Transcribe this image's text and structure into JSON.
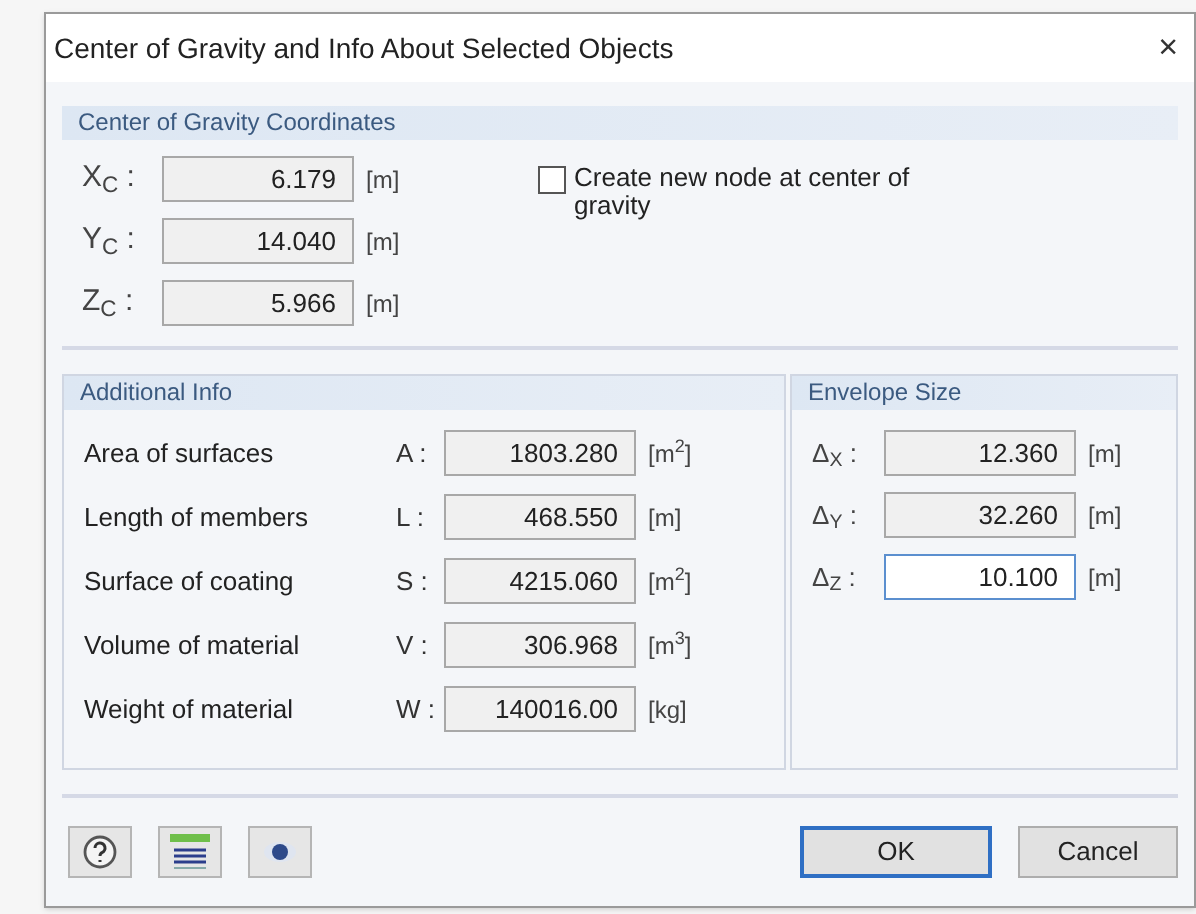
{
  "window": {
    "title": "Center of Gravity and Info About Selected Objects",
    "close": "×"
  },
  "coordinates": {
    "title": "Center of Gravity Coordinates",
    "rows": [
      {
        "label": "X$_{C}$ :",
        "value": "6.179",
        "unit": "[m]"
      },
      {
        "label": "Y$_{C}$ :",
        "value": "14.040",
        "unit": "[m]"
      },
      {
        "label": "Z$_{C}$ :",
        "value": "5.966",
        "unit": "[m]"
      }
    ],
    "checkbox": {
      "label": "Create new node at center of gravity",
      "checked": false
    }
  },
  "additional_info": {
    "title": "Additional Info",
    "rows": [
      {
        "name": "Area of surfaces",
        "symbol": "A :",
        "value": "1803.280",
        "unit": "[m$^{2}$]"
      },
      {
        "name": "Length of members",
        "symbol": "L :",
        "value": "468.550",
        "unit": "[m]"
      },
      {
        "name": "Surface of coating",
        "symbol": "S :",
        "value": "4215.060",
        "unit": "[m$^{2}$]"
      },
      {
        "name": "Volume of material",
        "symbol": "V :",
        "value": "306.968",
        "unit": "[m$^{3}$]"
      },
      {
        "name": "Weight of material",
        "symbol": "W :",
        "value": "140016.00",
        "unit": "[kg]"
      }
    ]
  },
  "envelope_size": {
    "title": "Envelope Size",
    "rows": [
      {
        "label": "Δ$_{X}$ :",
        "value": "12.360",
        "unit": "[m]",
        "focused": false
      },
      {
        "label": "Δ$_{Y}$ :",
        "value": "32.260",
        "unit": "[m]",
        "focused": false
      },
      {
        "label": "Δ$_{Z}$ :",
        "value": "10.100",
        "unit": "[m]",
        "focused": true
      }
    ]
  },
  "buttons": [
    {
      "label": "OK",
      "default": true
    },
    {
      "label": "Cancel",
      "default": false
    }
  ]
}
